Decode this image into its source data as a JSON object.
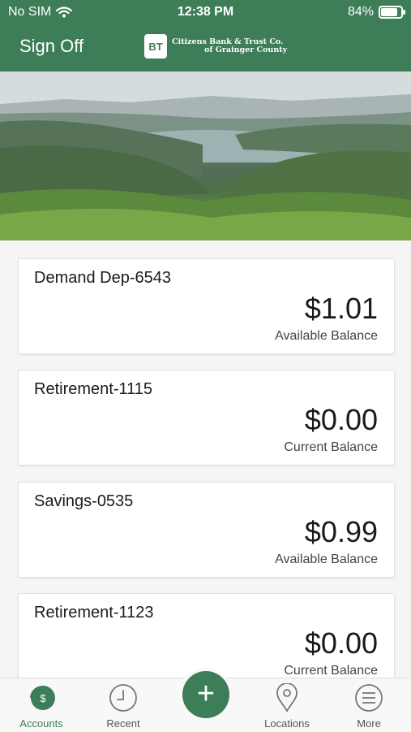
{
  "status_bar": {
    "carrier": "No SIM",
    "time": "12:38 PM",
    "battery": "84%"
  },
  "header": {
    "sign_off": "Sign Off",
    "logo_mark": "BT",
    "bank_name_line1": "Citizens Bank & Trust Co.",
    "bank_name_line2": "of Grainger County"
  },
  "accounts": [
    {
      "name": "Demand Dep-6543",
      "amount": "$1.01",
      "label": "Available Balance"
    },
    {
      "name": "Retirement-1115",
      "amount": "$0.00",
      "label": "Current Balance"
    },
    {
      "name": "Savings-0535",
      "amount": "$0.99",
      "label": "Available Balance"
    },
    {
      "name": "Retirement-1123",
      "amount": "$0.00",
      "label": "Current Balance"
    }
  ],
  "tabbar": {
    "accounts": "Accounts",
    "recent": "Recent",
    "locations": "Locations",
    "more": "More",
    "accounts_icon_text": "$"
  },
  "colors": {
    "brand_green": "#3d7d58"
  },
  "icons": [
    "wifi-icon",
    "battery-icon",
    "dollar-icon",
    "clock-icon",
    "plus-icon",
    "location-pin-icon",
    "menu-icon"
  ]
}
